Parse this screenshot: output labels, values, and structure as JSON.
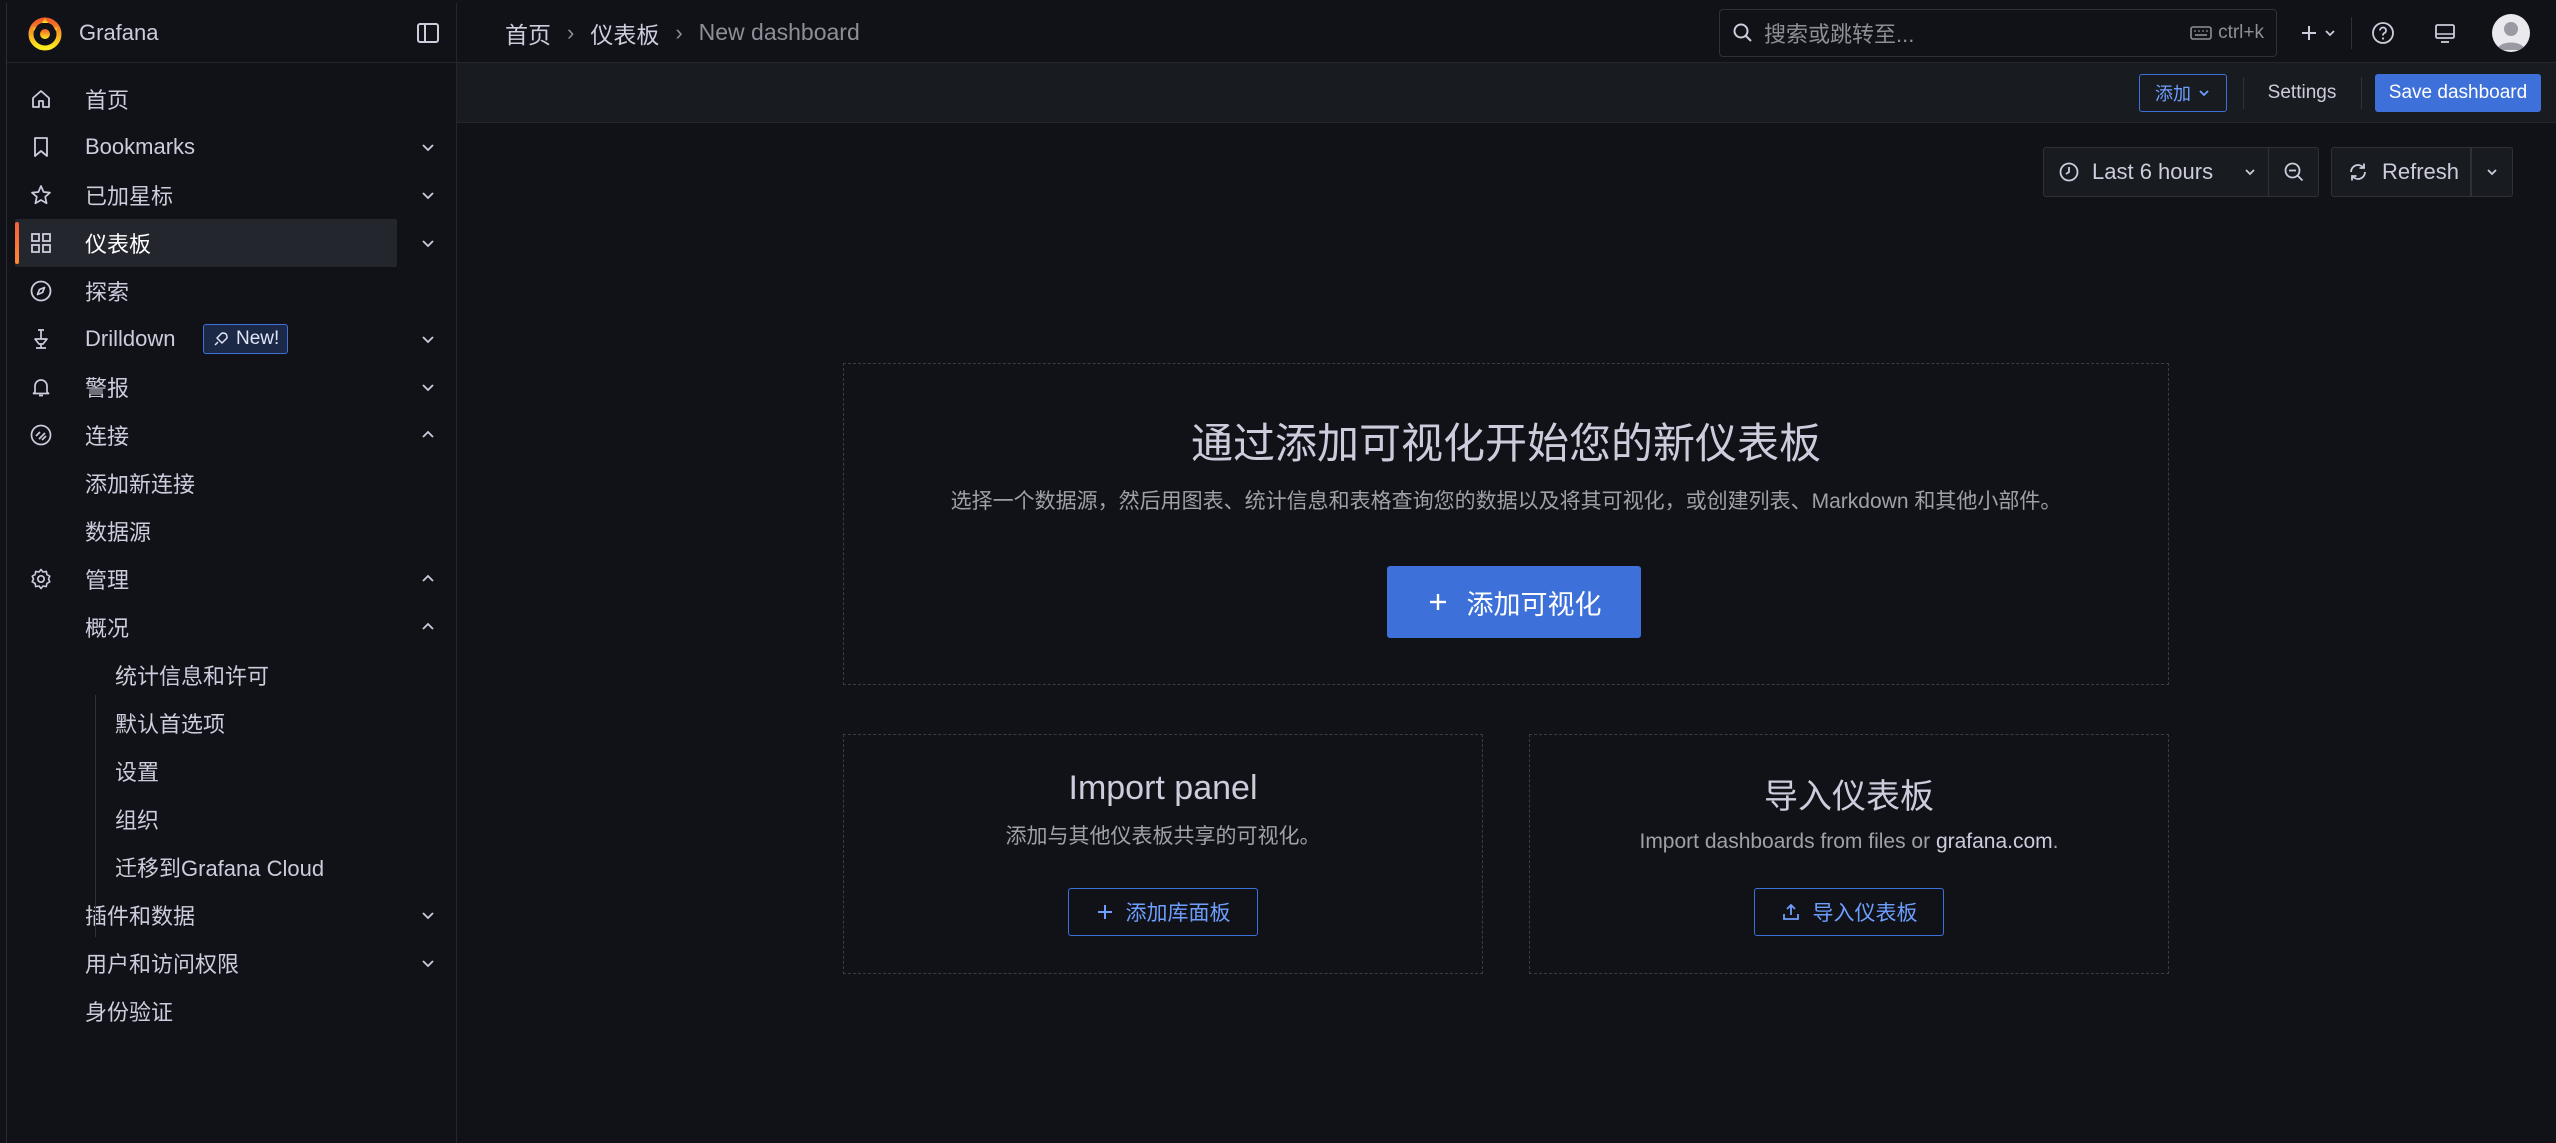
{
  "topbar": {
    "brand_name": "Grafana",
    "breadcrumb": [
      "首页",
      "仪表板",
      "New dashboard"
    ],
    "search_placeholder": "搜索或跳转至...",
    "search_shortcut": "ctrl+k"
  },
  "toolbar": {
    "add_label": "添加",
    "settings_label": "Settings",
    "save_label": "Save dashboard"
  },
  "time_controls": {
    "range_label": "Last 6 hours",
    "refresh_label": "Refresh"
  },
  "sidebar": {
    "items": [
      {
        "label": "首页",
        "icon": "home-icon",
        "chevron": ""
      },
      {
        "label": "Bookmarks",
        "icon": "bookmark-icon",
        "chevron": "down"
      },
      {
        "label": "已加星标",
        "icon": "star-icon",
        "chevron": "down"
      },
      {
        "label": "仪表板",
        "icon": "dashboards-icon",
        "chevron": "down",
        "active": true
      },
      {
        "label": "探索",
        "icon": "compass-icon",
        "chevron": ""
      },
      {
        "label": "Drilldown",
        "icon": "drilldown-icon",
        "chevron": "down",
        "badge": "New!"
      },
      {
        "label": "警报",
        "icon": "bell-icon",
        "chevron": "down"
      },
      {
        "label": "连接",
        "icon": "connections-icon",
        "chevron": "up"
      },
      {
        "label": "添加新连接",
        "level": 1
      },
      {
        "label": "数据源",
        "level": 1
      },
      {
        "label": "管理",
        "icon": "gear-icon",
        "chevron": "up"
      },
      {
        "label": "概况",
        "level": 1,
        "chevron": "up"
      },
      {
        "label": "统计信息和许可",
        "level": 2
      },
      {
        "label": "默认首选项",
        "level": 2
      },
      {
        "label": "设置",
        "level": 2
      },
      {
        "label": "组织",
        "level": 2
      },
      {
        "label": "迁移到Grafana Cloud",
        "level": 2
      },
      {
        "label": "插件和数据",
        "level": 1,
        "chevron": "down"
      },
      {
        "label": "用户和访问权限",
        "level": 1,
        "chevron": "down"
      },
      {
        "label": "身份验证",
        "level": 1
      }
    ]
  },
  "empty_state": {
    "title": "通过添加可视化开始您的新仪表板",
    "subtitle": "选择一个数据源，然后用图表、统计信息和表格查询您的数据以及将其可视化，或创建列表、Markdown 和其他小部件。",
    "add_viz_label": "添加可视化"
  },
  "import_panel": {
    "title": "Import panel",
    "description": "添加与其他仪表板共享的可视化。",
    "button_label": "添加库面板"
  },
  "import_dashboard": {
    "title": "导入仪表板",
    "description_prefix": "Import dashboards from files or ",
    "description_link": "grafana.com",
    "description_suffix": ".",
    "button_label": "导入仪表板"
  },
  "colors": {
    "accent": "#3d71d9",
    "background": "#111217",
    "active_bar": "#f55f3e"
  }
}
